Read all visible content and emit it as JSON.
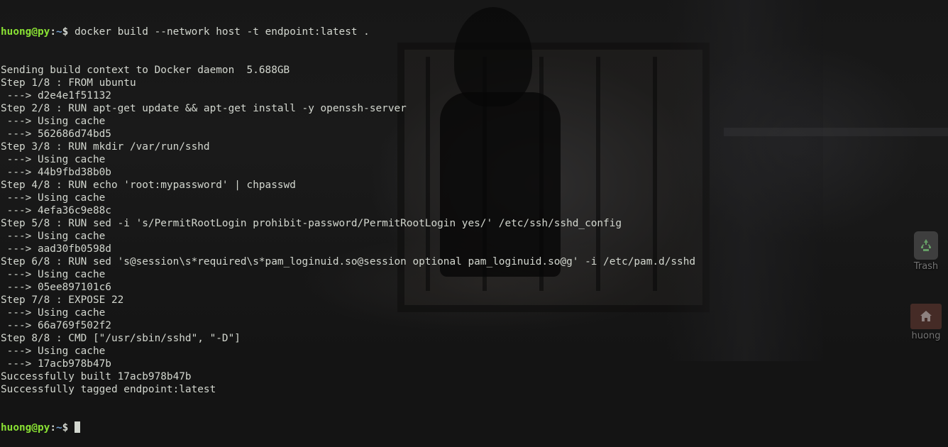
{
  "terminal": {
    "prompt": {
      "user_host": "huong@py",
      "separator": ":",
      "path": "~",
      "symbol": "$ "
    },
    "command": "docker build --network host -t endpoint:latest .",
    "output": [
      "Sending build context to Docker daemon  5.688GB",
      "Step 1/8 : FROM ubuntu",
      " ---> d2e4e1f51132",
      "Step 2/8 : RUN apt-get update && apt-get install -y openssh-server",
      " ---> Using cache",
      " ---> 562686d74bd5",
      "Step 3/8 : RUN mkdir /var/run/sshd",
      " ---> Using cache",
      " ---> 44b9fbd38b0b",
      "Step 4/8 : RUN echo 'root:mypassword' | chpasswd",
      " ---> Using cache",
      " ---> 4efa36c9e88c",
      "Step 5/8 : RUN sed -i 's/PermitRootLogin prohibit-password/PermitRootLogin yes/' /etc/ssh/sshd_config",
      " ---> Using cache",
      " ---> aad30fb0598d",
      "Step 6/8 : RUN sed 's@session\\s*required\\s*pam_loginuid.so@session optional pam_loginuid.so@g' -i /etc/pam.d/sshd",
      " ---> Using cache",
      " ---> 05ee897101c6",
      "Step 7/8 : EXPOSE 22",
      " ---> Using cache",
      " ---> 66a769f502f2",
      "Step 8/8 : CMD [\"/usr/sbin/sshd\", \"-D\"]",
      " ---> Using cache",
      " ---> 17acb978b47b",
      "Successfully built 17acb978b47b",
      "Successfully tagged endpoint:latest"
    ],
    "colors": {
      "text": "#d3d7cf",
      "user_host": "#8ae234",
      "path": "#729fcf"
    }
  },
  "desktop": {
    "icons": [
      {
        "label": "Trash",
        "icon": "trash-icon"
      },
      {
        "label": "huong",
        "icon": "home-folder-icon"
      }
    ]
  }
}
